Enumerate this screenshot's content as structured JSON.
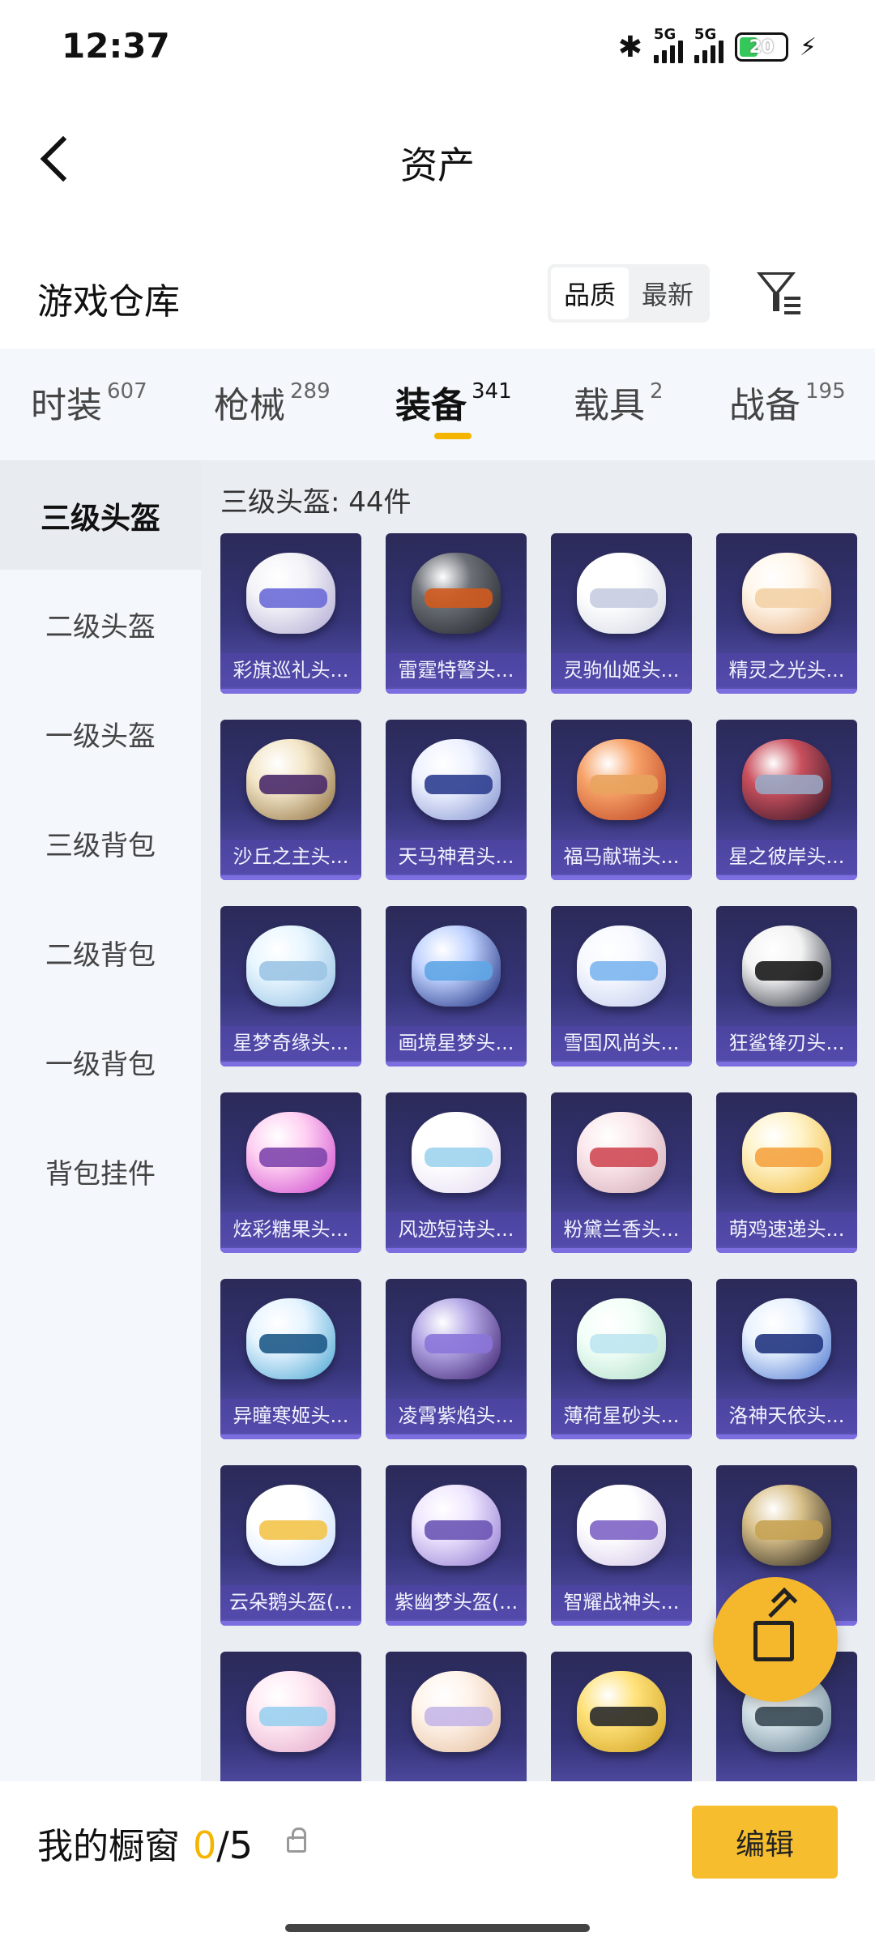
{
  "status": {
    "time": "12:37",
    "battery": "20",
    "net1": "5G",
    "net2": "5G"
  },
  "header": {
    "title": "资产"
  },
  "warehouse": {
    "title": "游戏仓库",
    "sort": [
      "品质",
      "最新"
    ]
  },
  "tabs": [
    {
      "label": "时装",
      "count": "607"
    },
    {
      "label": "枪械",
      "count": "289"
    },
    {
      "label": "装备",
      "count": "341"
    },
    {
      "label": "载具",
      "count": "2"
    },
    {
      "label": "战备",
      "count": "195"
    }
  ],
  "sidebar": [
    "三级头盔",
    "二级头盔",
    "一级头盔",
    "三级背包",
    "二级背包",
    "一级背包",
    "背包挂件"
  ],
  "main": {
    "count_label": "三级头盔: 44件",
    "items": [
      "彩旗巡礼头...",
      "雷霆特警头...",
      "灵驹仙姬头...",
      "精灵之光头...",
      "沙丘之主头...",
      "天马神君头...",
      "福马献瑞头...",
      "星之彼岸头...",
      "星梦奇缘头...",
      "画境星梦头...",
      "雪国风尚头...",
      "狂鲨锋刃头...",
      "炫彩糖果头...",
      "风迹短诗头...",
      "粉黛兰香头...",
      "萌鸡速递头...",
      "异瞳寒姬头...",
      "凌霄紫焰头...",
      "薄荷星砂头...",
      "洛神天依头...",
      "云朵鹅头盔(...",
      "紫幽梦头盔(...",
      "智耀战神头...",
      "",
      "",
      "",
      "",
      ""
    ]
  },
  "bottom": {
    "showcase": "我的橱窗",
    "current": "0",
    "total": "/5",
    "edit": "编辑"
  }
}
